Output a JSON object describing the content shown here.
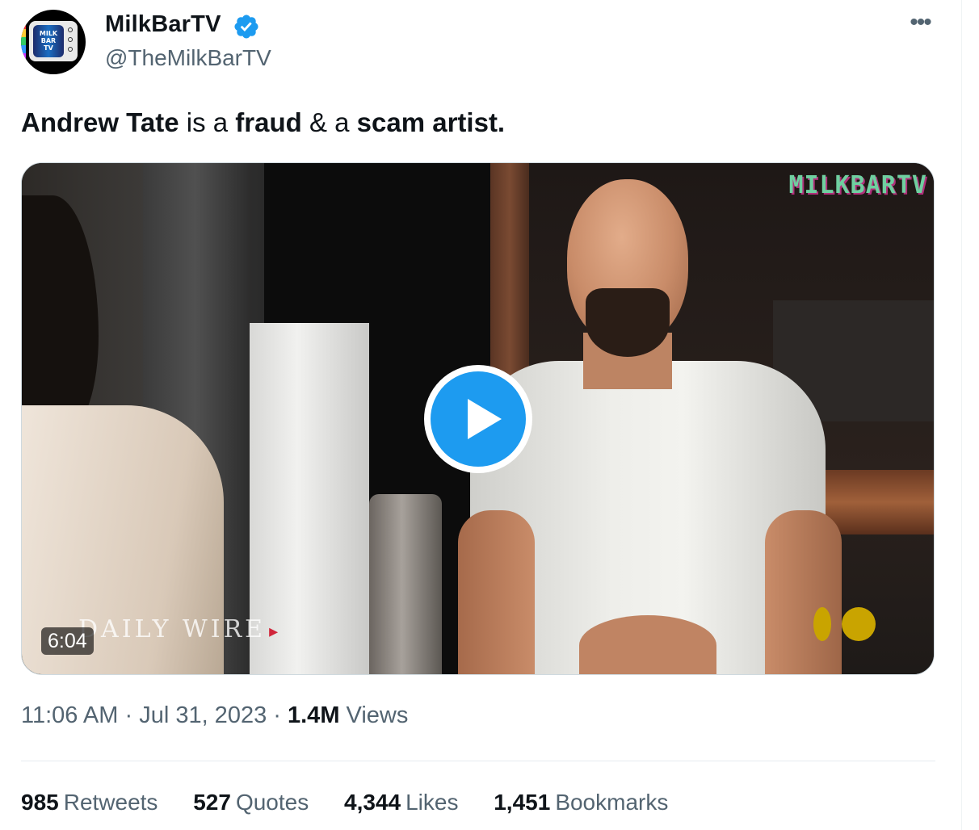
{
  "author": {
    "display_name": "MilkBarTV",
    "handle": "@TheMilkBarTV",
    "verified": true,
    "avatar_icon": "milkbar-tv-avatar",
    "avatar_text": [
      "MILK",
      "BAR",
      "TV"
    ]
  },
  "more_label": "•••",
  "tweet": {
    "segments": [
      {
        "text": "Andrew Tate",
        "bold": true
      },
      {
        "text": " is a ",
        "bold": false
      },
      {
        "text": "fraud",
        "bold": true
      },
      {
        "text": " & a ",
        "bold": false
      },
      {
        "text": "scam artist.",
        "bold": true
      }
    ]
  },
  "media": {
    "duration": "6:04",
    "watermark": "MILKBARTV",
    "overlay_logo": "DAILY WIRE",
    "play_icon": "play-icon",
    "accent": "#1d9bf0"
  },
  "meta": {
    "time": "11:06 AM",
    "separator": "·",
    "date": "Jul 31, 2023",
    "views_count": "1.4M",
    "views_label": "Views"
  },
  "stats": [
    {
      "count": "985",
      "label": "Retweets"
    },
    {
      "count": "527",
      "label": "Quotes"
    },
    {
      "count": "4,344",
      "label": "Likes"
    },
    {
      "count": "1,451",
      "label": "Bookmarks"
    }
  ],
  "colors": {
    "text": "#0f1419",
    "secondary": "#536471",
    "verified": "#1d9bf0"
  }
}
